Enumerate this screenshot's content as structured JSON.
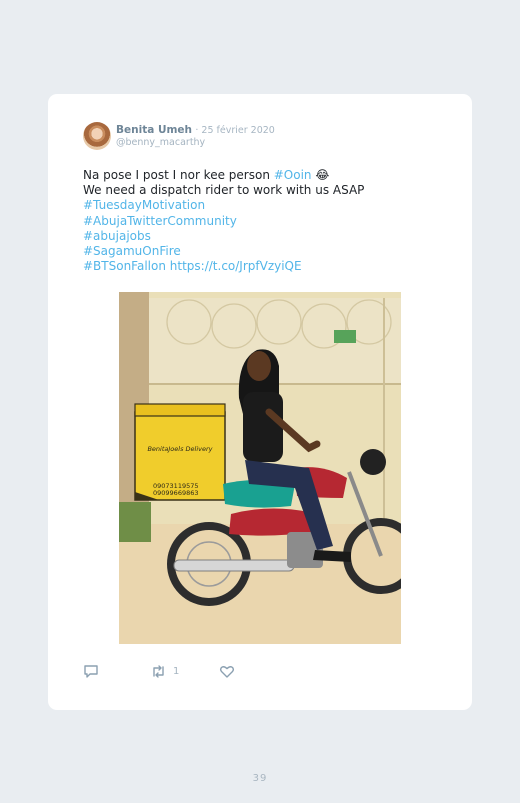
{
  "tweet": {
    "author_name": "Benita Umeh",
    "date": "· 25 février 2020",
    "handle": "@benny_macarthy",
    "line1_text": "Na pose I post I nor kee person ",
    "line1_link": "#Ooin",
    "line1_emoji": "😂",
    "line2": "We need a dispatch rider to work with us ASAP",
    "hashtags": [
      "#TuesdayMotivation",
      "#AbujaTwitterCommunity",
      "#abujajobs",
      "#SagamuOnFire",
      "#BTSonFallon"
    ],
    "url": "https://t.co/JrpfVzyiQE",
    "retweet_count": "1",
    "box_brand": "BenitaJoels Delivery",
    "box_phone_1": "09073119575",
    "box_phone_2": "09099669863"
  },
  "icons": {
    "reply": "speech-bubble-icon",
    "retweet": "retweet-arrows-icon",
    "like": "heart-outline-icon"
  },
  "colors": {
    "background": "#e9edf1",
    "card": "#ffffff",
    "link": "#52b5e8",
    "muted": "#a5b4c1"
  },
  "page": {
    "number": "39"
  }
}
